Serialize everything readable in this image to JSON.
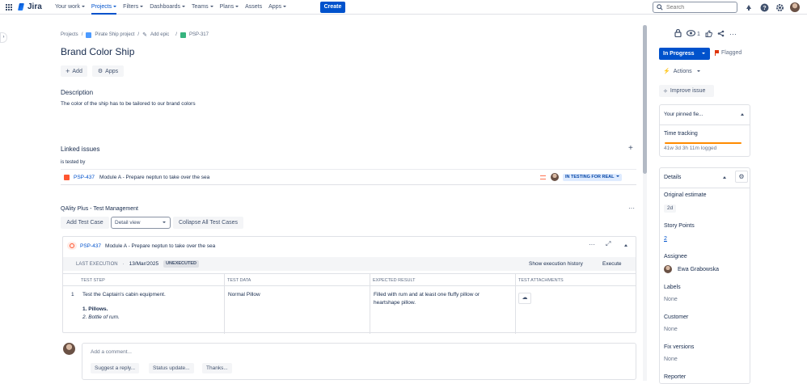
{
  "app": {
    "name": "Jira",
    "brand_color": "#0052cc"
  },
  "topnav": {
    "items": [
      {
        "label": "Your work",
        "dropdown": true
      },
      {
        "label": "Projects",
        "dropdown": true,
        "active": true
      },
      {
        "label": "Filters",
        "dropdown": true
      },
      {
        "label": "Dashboards",
        "dropdown": true
      },
      {
        "label": "Teams",
        "dropdown": true
      },
      {
        "label": "Plans",
        "dropdown": true
      },
      {
        "label": "Assets",
        "dropdown": false
      },
      {
        "label": "Apps",
        "dropdown": true
      }
    ],
    "create_label": "Create",
    "search_placeholder": "Search",
    "icons": [
      "notifications-icon",
      "help-icon",
      "settings-icon",
      "profile-avatar"
    ]
  },
  "breadcrumb": {
    "projects": "Projects",
    "project": "Pirate Ship project",
    "add_epic": "Add epic",
    "issue_key": "PSP-317"
  },
  "issue": {
    "title": "Brand Color Ship",
    "add_label": "Add",
    "apps_label": "Apps",
    "description_heading": "Description",
    "description_text": "The color of the ship has to be tailored to our brand colors"
  },
  "linked_issues": {
    "heading": "Linked issues",
    "relation": "is tested by",
    "items": [
      {
        "key": "PSP-437",
        "summary": "Module A - Prepare neptun to take over the sea",
        "status": "IN TESTING FOR REAL"
      }
    ]
  },
  "qality": {
    "heading": "QAlity Plus - Test Management",
    "add_test_case": "Add Test Case",
    "view_select": "Detail view",
    "collapse_all": "Collapse All Test Cases",
    "test_case": {
      "key": "PSP-437",
      "summary": "Module A - Prepare neptun to take over the sea",
      "last_execution_label": "LAST EXECUTION",
      "last_execution_date": "13/Mar/2025",
      "execution_status": "UNEXECUTED",
      "show_history": "Show execution history",
      "execute": "Execute",
      "columns": [
        "TEST STEP",
        "TEST DATA",
        "EXPECTED RESULT",
        "TEST ATTACHMENTS"
      ],
      "rows": [
        {
          "index": "1",
          "step": "Test the Captain's cabin equipment.",
          "step_bold": "Pillows.",
          "step_italic": "Bottle of rum.",
          "data": "Normal Pillow",
          "expected": "Filled with rum and at least one fluffy pillow or heartshape pillow."
        }
      ]
    }
  },
  "comment": {
    "placeholder": "Add a comment...",
    "suggestions": [
      "Suggest a reply...",
      "Status update...",
      "Thanks..."
    ]
  },
  "sidebar": {
    "watch_count": "1",
    "status": "In Progress",
    "flagged": "Flagged",
    "actions": "Actions",
    "improve_issue": "Improve issue",
    "pinned_fields": "Your pinned fie...",
    "time_tracking_label": "Time tracking",
    "time_logged": "41w 3d 3h 11m logged",
    "details": "Details",
    "fields": [
      {
        "label": "Original estimate",
        "value": "2d"
      },
      {
        "label": "Story Points",
        "value": "2"
      },
      {
        "label": "Assignee",
        "value": "Ewa Grabowska"
      },
      {
        "label": "Labels",
        "value": "None"
      },
      {
        "label": "Customer",
        "value": "None"
      },
      {
        "label": "Fix versions",
        "value": "None"
      },
      {
        "label": "Reporter",
        "value": ""
      }
    ]
  }
}
